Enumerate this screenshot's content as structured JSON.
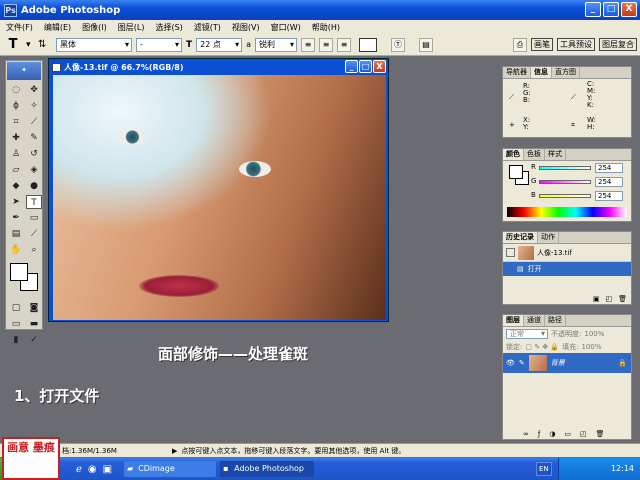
{
  "window": {
    "title": "Adobe Photoshop",
    "controls": [
      "_",
      "□",
      "X"
    ]
  },
  "menu": [
    "文件(F)",
    "编辑(E)",
    "图像(I)",
    "图层(L)",
    "选择(S)",
    "滤镜(T)",
    "视图(V)",
    "窗口(W)",
    "帮助(H)"
  ],
  "options": {
    "tool_glyph": "T",
    "font_family": "黑体",
    "font_style": "-",
    "font_size": "22 点",
    "aa_label": "a",
    "aa_mode": "锐利",
    "workspace_buttons": [
      "画笔",
      "工具预设",
      "图层复合"
    ]
  },
  "document": {
    "title": "人像-13.tif @ 66.7%(RGB/8)"
  },
  "info_panel": {
    "tabs": [
      "导航器",
      "信息",
      "直方图"
    ],
    "labels": {
      "r": "R:",
      "g": "G:",
      "b": "B:",
      "c": "C:",
      "m": "M:",
      "y": "Y:",
      "k": "K:",
      "x": "X:",
      "yy": "Y:",
      "w": "W:",
      "h": "H:"
    }
  },
  "color_panel": {
    "tabs": [
      "颜色",
      "色板",
      "样式"
    ],
    "channels": [
      {
        "name": "R",
        "value": "254"
      },
      {
        "name": "G",
        "value": "254"
      },
      {
        "name": "B",
        "value": "254"
      }
    ]
  },
  "history_panel": {
    "tabs": [
      "历史记录",
      "动作"
    ],
    "snapshot": "人像-13.tif",
    "items": [
      "打开"
    ]
  },
  "layers_panel": {
    "tabs": [
      "图层",
      "通道",
      "路径"
    ],
    "blend_mode": "正常",
    "opacity_label": "不透明度:",
    "opacity": "100%",
    "lock_label": "锁定:",
    "fill_label": "填充:",
    "fill": "100%",
    "layer_name": "背景"
  },
  "overlay": {
    "title": "面部修饰——处理雀斑",
    "step": "1、打开文件"
  },
  "status": {
    "doc": "档:1.36M/1.36M",
    "hint": "点按可键入点文本，拖移可键入段落文字。要用其他选项，使用 Alt 键。"
  },
  "taskbar": {
    "items": [
      "CDimage",
      "Adobe Photoshop"
    ],
    "lang": "EN",
    "clock": "12:14"
  },
  "seal_text": "画意 墨痕",
  "colors": {
    "titlebar": "#0a4fd6",
    "canvas_bg": "#6b6b72",
    "accent": "#316ac5"
  }
}
